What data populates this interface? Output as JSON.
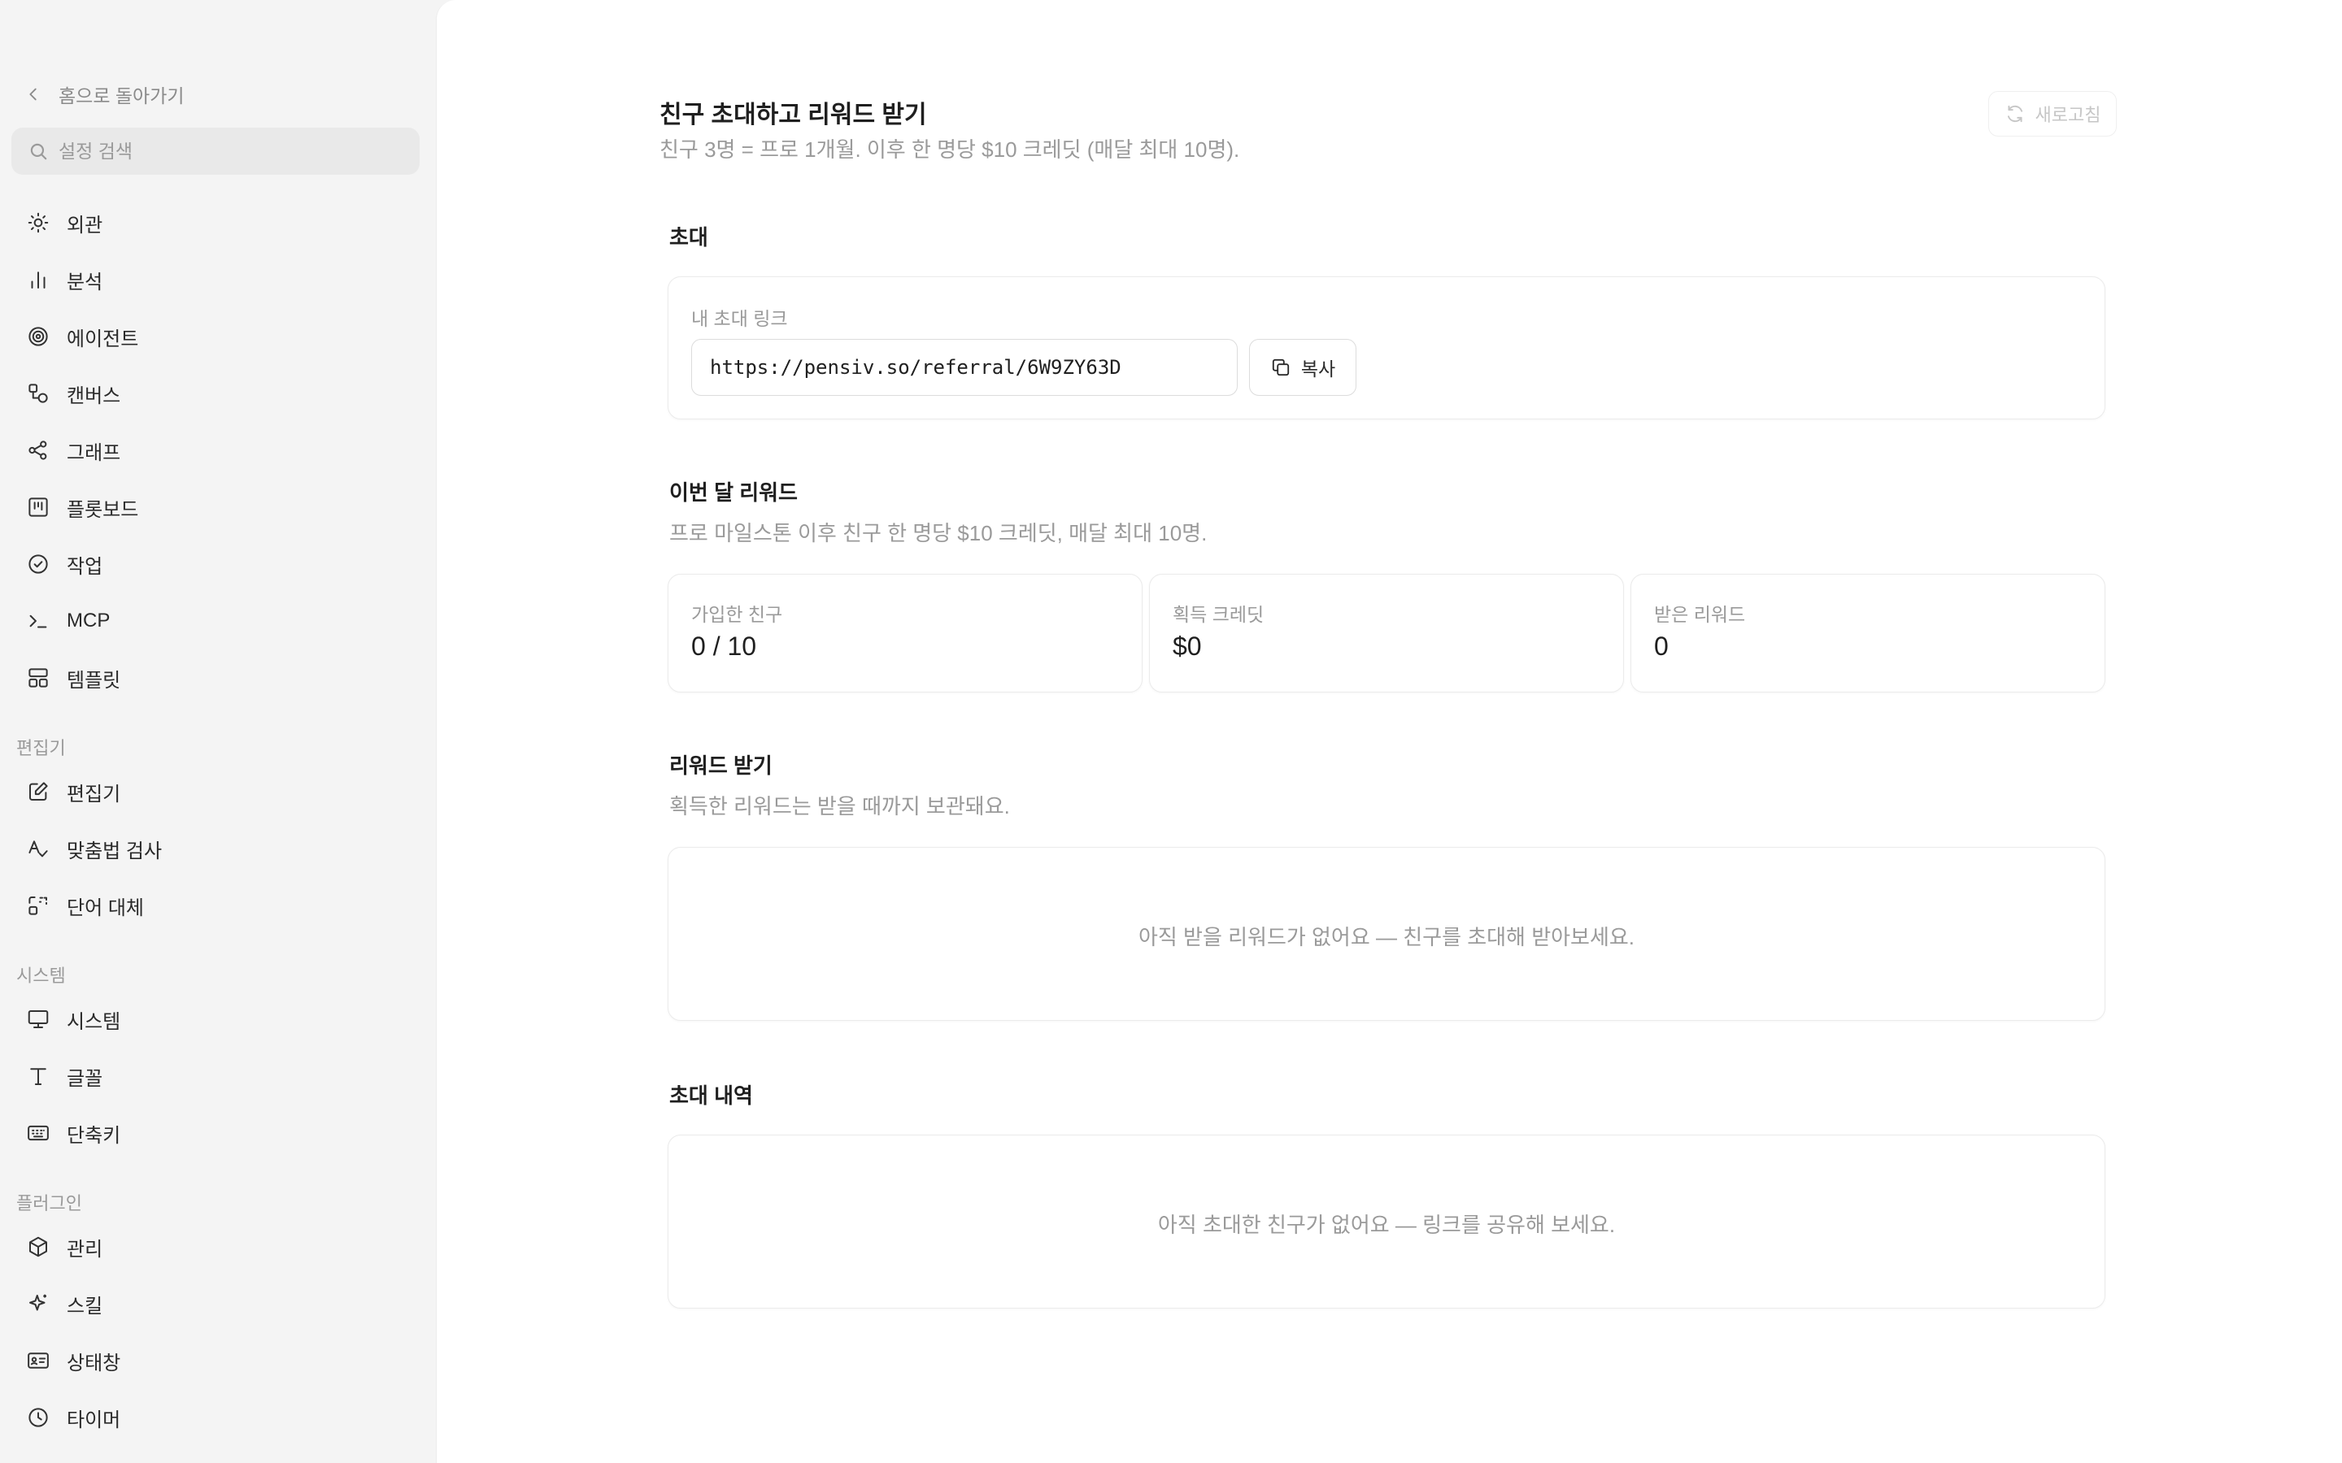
{
  "sidebar": {
    "back_label": "홈으로 돌아가기",
    "search_placeholder": "설정 검색",
    "items": [
      {
        "label": "외관"
      },
      {
        "label": "분석"
      },
      {
        "label": "에이전트"
      },
      {
        "label": "캔버스"
      },
      {
        "label": "그래프"
      },
      {
        "label": "플롯보드"
      },
      {
        "label": "작업"
      },
      {
        "label": "MCP"
      },
      {
        "label": "템플릿"
      }
    ],
    "editor_section": {
      "label": "편집기",
      "items": [
        {
          "label": "편집기"
        },
        {
          "label": "맞춤법 검사"
        },
        {
          "label": "단어 대체"
        }
      ]
    },
    "system_section": {
      "label": "시스템",
      "items": [
        {
          "label": "시스템"
        },
        {
          "label": "글꼴"
        },
        {
          "label": "단축키"
        }
      ]
    },
    "plugin_section": {
      "label": "플러그인",
      "items": [
        {
          "label": "관리"
        },
        {
          "label": "스킬"
        },
        {
          "label": "상태창"
        },
        {
          "label": "타이머"
        }
      ]
    }
  },
  "main": {
    "title": "친구 초대하고 리워드 받기",
    "subtitle": "친구 3명 = 프로 1개월. 이후 한 명당 $10 크레딧 (매달 최대 10명).",
    "refresh_label": "새로고침",
    "invite": {
      "title": "초대",
      "field_label": "내 초대 링크",
      "link_value": "https://pensiv.so/referral/6W9ZY63D",
      "copy_label": "복사"
    },
    "monthly": {
      "title": "이번 달 리워드",
      "subtitle": "프로 마일스톤 이후 친구 한 명당 $10 크레딧, 매달 최대 10명.",
      "stats": [
        {
          "label": "가입한 친구",
          "value": "0 / 10"
        },
        {
          "label": "획득 크레딧",
          "value": "$0"
        },
        {
          "label": "받은 리워드",
          "value": "0"
        }
      ]
    },
    "claim": {
      "title": "리워드 받기",
      "subtitle": "획득한 리워드는 받을 때까지 보관돼요.",
      "empty": "아직 받을 리워드가 없어요 — 친구를 초대해 받아보세요."
    },
    "history": {
      "title": "초대 내역",
      "empty": "아직 초대한 친구가 없어요 — 링크를 공유해 보세요."
    }
  }
}
